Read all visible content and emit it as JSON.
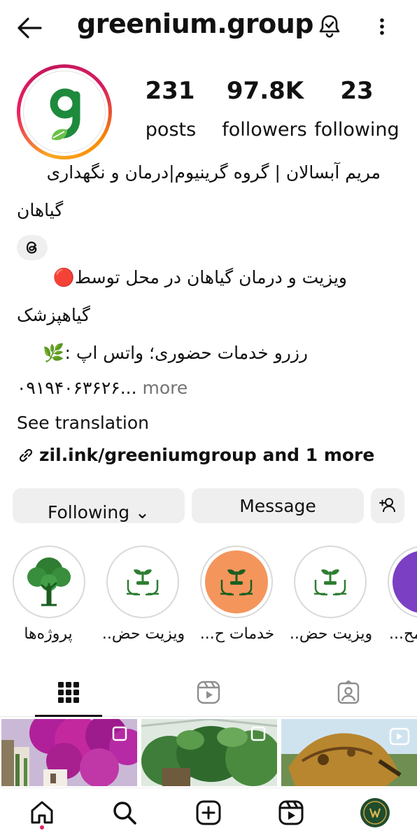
{
  "profile": {
    "username": "greenium.group",
    "stats": [
      {
        "value": "231",
        "label": "posts"
      },
      {
        "value": "97.8K",
        "label": "followers"
      },
      {
        "value": "23",
        "label": "following"
      }
    ]
  },
  "bio": {
    "name_line1": "مریم آبسالان | گروه گرینیوم|درمان و نگهداری",
    "name_line2": "گیاهان",
    "desc_line1": "ویزیت و درمان گیاهان در محل توسط🔴",
    "desc_line2": "گیاهپزشک",
    "desc_line3": "رزرو خدمات حضوری؛ واتس اپ :🌿",
    "phone": "۰۹۱۹۴۰۶۳۶۲۶...",
    "more": " more",
    "see_translation": "See translation",
    "link": "zil.ink/greeniumgroup and 1 more"
  },
  "actions": {
    "following": "Following",
    "message": "Message"
  },
  "highlights": [
    {
      "label": "پروژه‌ها"
    },
    {
      "label": "ویزیت حض.."
    },
    {
      "label": "خدمات ح..."
    },
    {
      "label": "ویزیت حض.."
    },
    {
      "label": "مح..."
    }
  ],
  "colors": {
    "brand_green": "#1e8a3c",
    "highlight_orange": "#f4955c",
    "highlight_purple": "#7b3fc4",
    "button_gray": "#efefef",
    "notification_dot": "#e0245e"
  },
  "icons": {
    "back": "arrow-left-icon",
    "bell": "bell-icon",
    "menu": "more-vertical-icon",
    "threads": "threads-icon",
    "link": "link-icon",
    "add_user": "add-user-icon"
  }
}
